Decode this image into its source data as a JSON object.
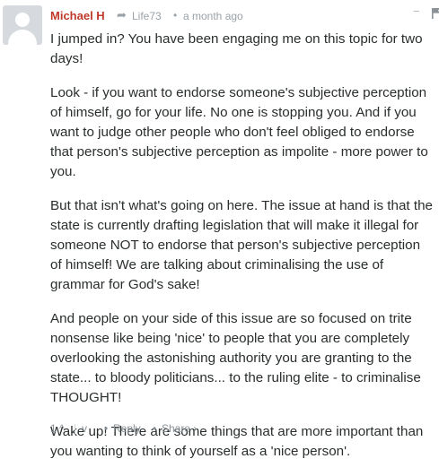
{
  "comment": {
    "author": "Michael H",
    "reply_to": "Life73",
    "bullet": "•",
    "time": "a month ago",
    "collapse_symbol": "−",
    "paragraphs": [
      "I jumped in? You have been engaging me on this topic for two days!",
      "Look - if you want to endorse someone's subjective perception of himself, go for your life. No one is stopping you. And if you want to judge other people who don't feel obliged to endorse that person's subjective perception as impolite - more power to you.",
      "But that isn't what's going on here. The issue at hand is that the state is currently drafting legislation that will make it illegal for someone NOT to endorse that person's subjective perception of himself! We are talking about criminalising the use of grammar for God's sake!",
      "And people on your side of this issue are so focused on trite nonsense like being 'nice' to people that you are completely overlooking the astonishing authority you are granting to the state... to bloody politicians... to the ruling elite - to criminalise THOUGHT!",
      "Wake up! There are some things that are more important than you wanting to think of yourself as a 'nice person'."
    ],
    "footer": {
      "vote_count": "1",
      "upvote_symbol": "^",
      "separator": "|",
      "downvote_symbol": "v",
      "dot": "•",
      "reply_label": "Reply",
      "share_label": "Share ›"
    }
  },
  "colors": {
    "author": "#c0392b",
    "meta": "#9aa2a8",
    "text": "#2a2e2e",
    "avatar_bg": "#d6dade"
  }
}
